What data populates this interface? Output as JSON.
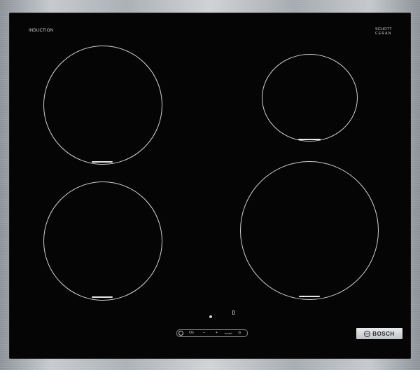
{
  "labels": {
    "induction": "INDUCTION",
    "brand_top_1": "SCHOTT",
    "brand_top_2": "CERAN",
    "brand": "BOSCH",
    "control_on": "On",
    "control_minus": "–",
    "control_plus": "+",
    "control_boost": "boost ·",
    "control_timer": "◷"
  },
  "icons": {
    "power": "power-icon",
    "brand_logo": "bosch-logo-icon",
    "zone_select": "zone-selector-icon"
  },
  "colors": {
    "glass": "#050505",
    "frame": "#b8bcc0",
    "zone_line": "#d0d0d0"
  }
}
